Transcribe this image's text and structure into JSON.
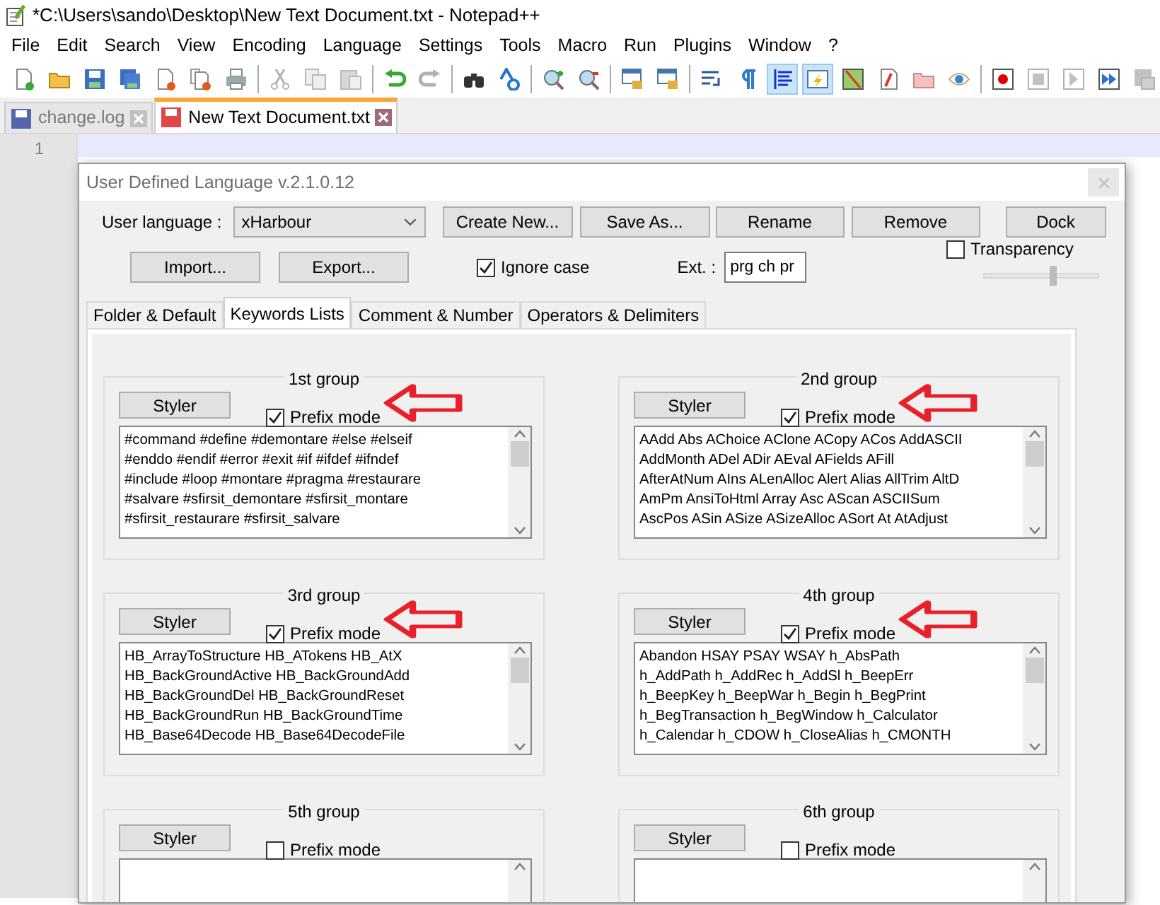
{
  "window": {
    "title": "*C:\\Users\\sando\\Desktop\\New Text Document.txt - Notepad++"
  },
  "menu": [
    "File",
    "Edit",
    "Search",
    "View",
    "Encoding",
    "Language",
    "Settings",
    "Tools",
    "Macro",
    "Run",
    "Plugins",
    "Window",
    "?"
  ],
  "toolbar_groups": [
    [
      {
        "kind": "new",
        "pressed": false,
        "disabled": false
      },
      {
        "kind": "open",
        "pressed": false,
        "disabled": false
      },
      {
        "kind": "save",
        "pressed": false,
        "disabled": false
      },
      {
        "kind": "saveall",
        "pressed": false,
        "disabled": false
      },
      {
        "kind": "close",
        "pressed": false,
        "disabled": false
      },
      {
        "kind": "closeall",
        "pressed": false,
        "disabled": false
      },
      {
        "kind": "print",
        "pressed": false,
        "disabled": false
      }
    ],
    [
      {
        "kind": "cut",
        "pressed": false,
        "disabled": true
      },
      {
        "kind": "copy",
        "pressed": false,
        "disabled": true
      },
      {
        "kind": "paste",
        "pressed": false,
        "disabled": true
      }
    ],
    [
      {
        "kind": "undo",
        "pressed": false,
        "disabled": false
      },
      {
        "kind": "redo",
        "pressed": false,
        "disabled": true
      }
    ],
    [
      {
        "kind": "find",
        "pressed": false,
        "disabled": false
      },
      {
        "kind": "replace",
        "pressed": false,
        "disabled": false
      }
    ],
    [
      {
        "kind": "zoomin",
        "pressed": false,
        "disabled": false
      },
      {
        "kind": "zoomout",
        "pressed": false,
        "disabled": false
      }
    ],
    [
      {
        "kind": "syncv",
        "pressed": false,
        "disabled": false
      },
      {
        "kind": "synch",
        "pressed": false,
        "disabled": false
      }
    ],
    [
      {
        "kind": "wrap",
        "pressed": false,
        "disabled": false
      },
      {
        "kind": "pilcrow",
        "pressed": false,
        "disabled": false
      },
      {
        "kind": "indent",
        "pressed": true,
        "disabled": false
      },
      {
        "kind": "udl",
        "pressed": true,
        "disabled": false
      },
      {
        "kind": "map",
        "pressed": false,
        "disabled": false
      },
      {
        "kind": "function",
        "pressed": false,
        "disabled": false
      },
      {
        "kind": "folder",
        "pressed": false,
        "disabled": false
      },
      {
        "kind": "eye",
        "pressed": false,
        "disabled": false
      }
    ],
    [
      {
        "kind": "record",
        "pressed": false,
        "disabled": false
      },
      {
        "kind": "stop",
        "pressed": false,
        "disabled": true
      },
      {
        "kind": "play",
        "pressed": false,
        "disabled": true
      },
      {
        "kind": "playmulti",
        "pressed": false,
        "disabled": false
      },
      {
        "kind": "savemacro",
        "pressed": false,
        "disabled": true
      }
    ]
  ],
  "doc_tabs": [
    {
      "label": "change.log",
      "selected": false,
      "modified": false
    },
    {
      "label": "New Text Document.txt",
      "selected": true,
      "modified": true
    }
  ],
  "editor": {
    "line_numbers": [
      "1"
    ]
  },
  "dialog": {
    "title": "User Defined Language v.2.1.0.12",
    "user_language_label": "User language :",
    "user_language": "xHarbour",
    "top_buttons": [
      "Create New...",
      "Save As...",
      "Rename",
      "Remove",
      "Dock"
    ],
    "import_button": "Import...",
    "export_button": "Export...",
    "ignore_case": {
      "label": "Ignore case",
      "checked": true
    },
    "ext_label": "Ext. :",
    "ext_value": "prg ch pr",
    "transparency": {
      "label": "Transparency",
      "checked": false,
      "level": 0.6
    },
    "tabs": [
      {
        "label": "Folder & Default",
        "selected": false
      },
      {
        "label": "Keywords Lists",
        "selected": true
      },
      {
        "label": "Comment & Number",
        "selected": false
      },
      {
        "label": "Operators & Delimiters",
        "selected": false
      }
    ],
    "groups": [
      {
        "title": "1st group",
        "styler": "Styler",
        "prefix_label": "Prefix mode",
        "prefix_mode": true,
        "arrow": true,
        "lines": [
          "#command #define #demontare #else #elseif",
          "#enddo #endif #error #exit #if #ifdef #ifndef",
          "#include #loop #montare #pragma #restaurare",
          "#salvare #sfirsit_demontare #sfirsit_montare",
          "#sfirsit_restaurare #sfirsit_salvare"
        ]
      },
      {
        "title": "2nd group",
        "styler": "Styler",
        "prefix_label": "Prefix mode",
        "prefix_mode": true,
        "arrow": true,
        "lines": [
          "AAdd Abs AChoice AClone ACopy ACos AddASCII",
          "AddMonth ADel ADir AEval AFields AFill",
          "AfterAtNum AIns ALenAlloc Alert Alias AllTrim AltD",
          "AmPm AnsiToHtml Array Asc AScan ASCIISum",
          "AscPos ASin ASize ASizeAlloc ASort At AtAdjust"
        ]
      },
      {
        "title": "3rd group",
        "styler": "Styler",
        "prefix_label": "Prefix mode",
        "prefix_mode": true,
        "arrow": true,
        "lines": [
          "HB_ArrayToStructure HB_ATokens HB_AtX",
          "HB_BackGroundActive HB_BackGroundAdd",
          "HB_BackGroundDel HB_BackGroundReset",
          "HB_BackGroundRun HB_BackGroundTime",
          "HB_Base64Decode HB_Base64DecodeFile"
        ]
      },
      {
        "title": "4th group",
        "styler": "Styler",
        "prefix_label": "Prefix mode",
        "prefix_mode": true,
        "arrow": true,
        "lines": [
          "Abandon HSAY PSAY WSAY h_AbsPath",
          "h_AddPath h_AddRec h_AddSl h_BeepErr",
          "h_BeepKey h_BeepWar h_Begin h_BegPrint",
          "h_BegTransaction h_BegWindow h_Calculator",
          "h_Calendar h_CDOW h_CloseAlias h_CMONTH"
        ]
      },
      {
        "title": "5th group",
        "styler": "Styler",
        "prefix_label": "Prefix mode",
        "prefix_mode": false,
        "arrow": false
      },
      {
        "title": "6th group",
        "styler": "Styler",
        "prefix_label": "Prefix mode",
        "prefix_mode": false,
        "arrow": false
      }
    ]
  }
}
